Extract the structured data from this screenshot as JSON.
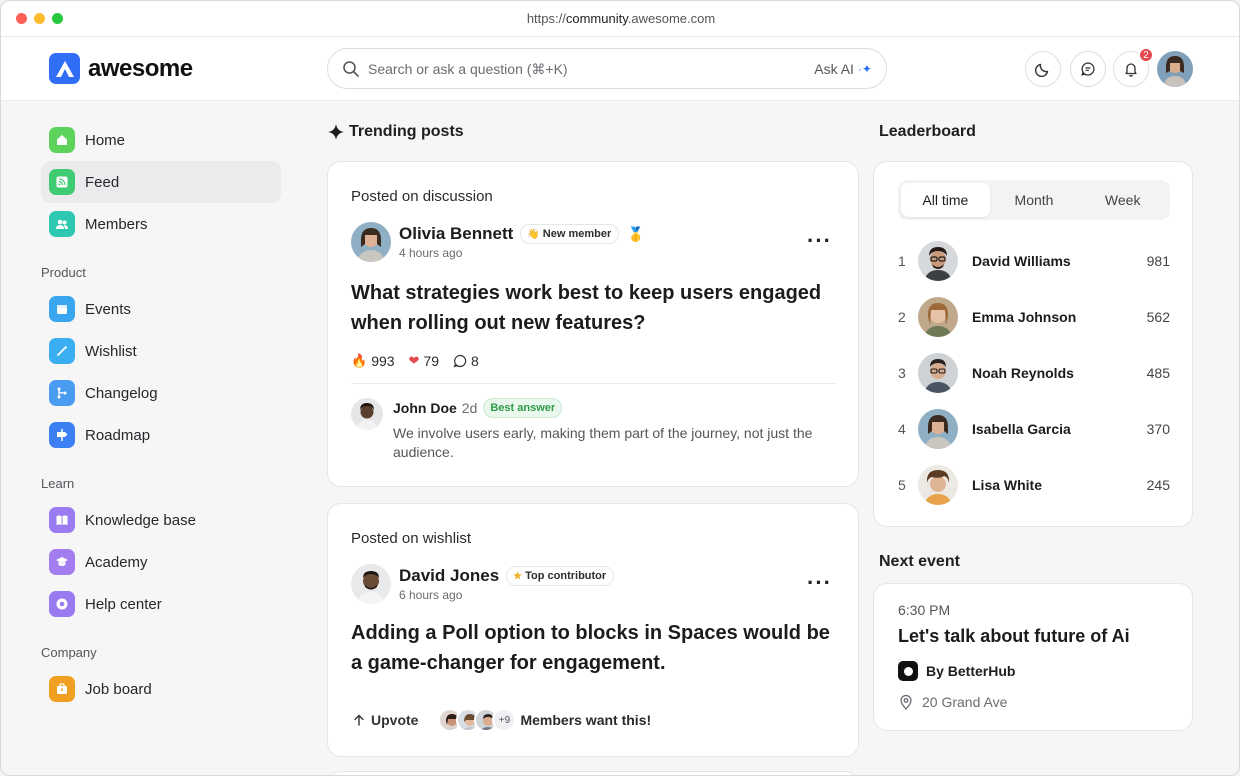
{
  "browser": {
    "url_prefix": "https://",
    "url_domain": "community",
    "url_suffix": ".awesome.com"
  },
  "header": {
    "logo_text": "awesome",
    "search_placeholder": "Search or ask a question (⌘+K)",
    "ask_ai_label": "Ask AI",
    "notification_count": "2"
  },
  "sidebar": {
    "top": [
      {
        "label": "Home",
        "icon": "home-icon",
        "color": "#5dd35c"
      },
      {
        "label": "Feed",
        "icon": "rss-icon",
        "color": "#3ecb71"
      },
      {
        "label": "Members",
        "icon": "users-icon",
        "color": "#2cc9b0"
      }
    ],
    "product_label": "Product",
    "product": [
      {
        "label": "Events",
        "icon": "calendar-icon",
        "color": "#3aa6f0"
      },
      {
        "label": "Wishlist",
        "icon": "wand-icon",
        "color": "#3aaef0"
      },
      {
        "label": "Changelog",
        "icon": "branch-icon",
        "color": "#4a9cf2"
      },
      {
        "label": "Roadmap",
        "icon": "signpost-icon",
        "color": "#3b7ff2"
      }
    ],
    "learn_label": "Learn",
    "learn": [
      {
        "label": "Knowledge base",
        "icon": "book-icon",
        "color": "#9b7cf0"
      },
      {
        "label": "Academy",
        "icon": "graduation-cap-icon",
        "color": "#a27ef0"
      },
      {
        "label": "Help center",
        "icon": "lifebuoy-icon",
        "color": "#9a7af0"
      }
    ],
    "company_label": "Company",
    "company": [
      {
        "label": "Job board",
        "icon": "briefcase-icon",
        "color": "#f0a020"
      }
    ]
  },
  "main": {
    "title": "Trending posts",
    "posts": [
      {
        "posted_on": "Posted on discussion",
        "author": "Olivia Bennett",
        "tag": "New member",
        "time": "4 hours ago",
        "title": "What strategies work best to keep users engaged when rolling out new features?",
        "fire": "993",
        "hearts": "79",
        "comments": "8",
        "answer": {
          "name": "John Doe",
          "time": "2d",
          "badge": "Best answer",
          "text": "We involve users early, making them part of the journey, not just the audience."
        }
      },
      {
        "posted_on": "Posted on wishlist",
        "author": "David Jones",
        "tag": "Top contributor",
        "time": "6 hours ago",
        "title": "Adding a Poll option to blocks in Spaces would be a game-changer for engagement.",
        "upvote": "Upvote",
        "extra_count": "+9",
        "members_want": "Members want this!"
      }
    ]
  },
  "leaderboard": {
    "title": "Leaderboard",
    "tabs": [
      "All time",
      "Month",
      "Week"
    ],
    "active_tab": "All time",
    "rows": [
      {
        "rank": "1",
        "name": "David Williams",
        "score": "981"
      },
      {
        "rank": "2",
        "name": "Emma Johnson",
        "score": "562"
      },
      {
        "rank": "3",
        "name": "Noah Reynolds",
        "score": "485"
      },
      {
        "rank": "4",
        "name": "Isabella Garcia",
        "score": "370"
      },
      {
        "rank": "5",
        "name": "Lisa White",
        "score": "245"
      }
    ]
  },
  "next_event": {
    "title": "Next event",
    "time": "6:30 PM",
    "name": "Let's talk about future of Ai",
    "by": "By BetterHub",
    "location": "20 Grand Ave"
  }
}
